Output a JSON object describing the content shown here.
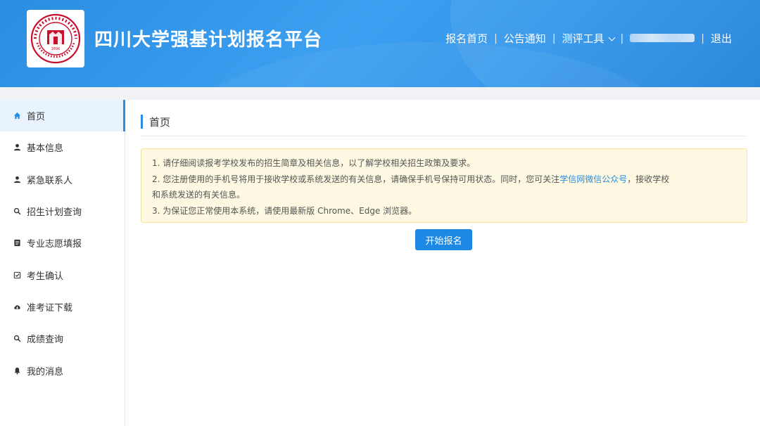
{
  "header": {
    "title": "四川大学强基计划报名平台",
    "logo_text": "SICHUAN UNIVERSITY 1896",
    "nav": {
      "home": "报名首页",
      "notice": "公告通知",
      "tools": "测评工具",
      "logout": "退出",
      "separator": "|"
    }
  },
  "sidebar": {
    "items": [
      {
        "label": "首页",
        "icon": "home-icon",
        "active": true
      },
      {
        "label": "基本信息",
        "icon": "user-icon"
      },
      {
        "label": "紧急联系人",
        "icon": "user-icon"
      },
      {
        "label": "招生计划查询",
        "icon": "search-icon"
      },
      {
        "label": "专业志愿填报",
        "icon": "form-icon"
      },
      {
        "label": "考生确认",
        "icon": "checkbox-icon"
      },
      {
        "label": "准考证下载",
        "icon": "cloud-download-icon"
      },
      {
        "label": "成绩查询",
        "icon": "search-icon"
      },
      {
        "label": "我的消息",
        "icon": "bell-icon"
      }
    ]
  },
  "main": {
    "page_title": "首页",
    "notice": {
      "line1": "1. 请仔细阅读报考学校发布的招生简章及相关信息，以了解学校相关招生政策及要求。",
      "line2_pre": "2. 您注册使用的手机号将用于接收学校或系统发送的有关信息，请确保手机号保持可用状态。同时，您可关注",
      "line2_link": "学信网微信公众号",
      "line2_post": "，接收学校",
      "line2_cont": "和系统发送的有关信息。",
      "line3": "3. 为保证您正常使用本系统，请使用最新版 Chrome、Edge 浏览器。"
    },
    "start_button": "开始报名"
  },
  "colors": {
    "accent": "#2a8de0",
    "button": "#1e88e5",
    "notice_bg": "#fdf8e1",
    "seal_red": "#c8102e"
  }
}
